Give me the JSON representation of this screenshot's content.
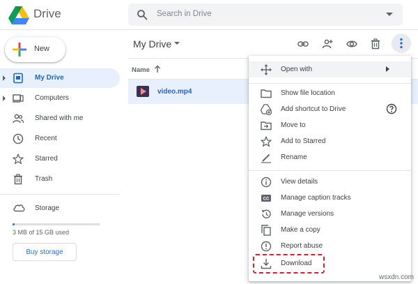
{
  "app": {
    "name": "Drive",
    "logo_icon": "google-drive-logo"
  },
  "search": {
    "placeholder": "Search in Drive",
    "icon": "search-icon",
    "options_icon": "caret-down-icon"
  },
  "sidebar": {
    "new_label": "New",
    "items": [
      {
        "label": "My Drive",
        "icon": "my-drive-icon",
        "active": true,
        "expandable": true
      },
      {
        "label": "Computers",
        "icon": "computers-icon",
        "active": false,
        "expandable": true
      },
      {
        "label": "Shared with me",
        "icon": "shared-with-me-icon",
        "active": false,
        "expandable": false
      },
      {
        "label": "Recent",
        "icon": "recent-icon",
        "active": false,
        "expandable": false
      },
      {
        "label": "Starred",
        "icon": "starred-icon",
        "active": false,
        "expandable": false
      },
      {
        "label": "Trash",
        "icon": "trash-icon",
        "active": false,
        "expandable": false
      }
    ],
    "storage": {
      "label": "Storage",
      "used_text": "3 MB of 15 GB used",
      "used_fraction": 0.0002,
      "buy_label": "Buy storage"
    }
  },
  "main": {
    "title": "My Drive",
    "toolbar": [
      "get-link-icon",
      "share-icon",
      "preview-icon",
      "trash-icon",
      "more-vert-icon"
    ],
    "column_name": "Name",
    "sort": "ascending",
    "files": [
      {
        "name": "video.mp4",
        "type": "video",
        "selected": true
      }
    ]
  },
  "context_menu": {
    "items": [
      {
        "label": "Open with",
        "icon": "open-with-icon",
        "submenu": true,
        "hover": true
      },
      {
        "label": "Show file location",
        "icon": "folder-icon"
      },
      {
        "label": "Add shortcut to Drive",
        "icon": "add-shortcut-icon",
        "help": true
      },
      {
        "label": "Move to",
        "icon": "move-to-icon"
      },
      {
        "label": "Add to Starred",
        "icon": "star-icon"
      },
      {
        "label": "Rename",
        "icon": "rename-icon"
      },
      {
        "label": "View details",
        "icon": "info-icon"
      },
      {
        "label": "Manage caption tracks",
        "icon": "captions-icon"
      },
      {
        "label": "Manage versions",
        "icon": "versions-icon"
      },
      {
        "label": "Make a copy",
        "icon": "copy-icon"
      },
      {
        "label": "Report abuse",
        "icon": "report-icon"
      },
      {
        "label": "Download",
        "icon": "download-icon",
        "highlighted": true
      }
    ]
  },
  "colors": {
    "accent": "#1a73e8",
    "active_bg": "#e8f0fe",
    "highlight": "#e31b23"
  },
  "watermark": "wsxdn.com"
}
